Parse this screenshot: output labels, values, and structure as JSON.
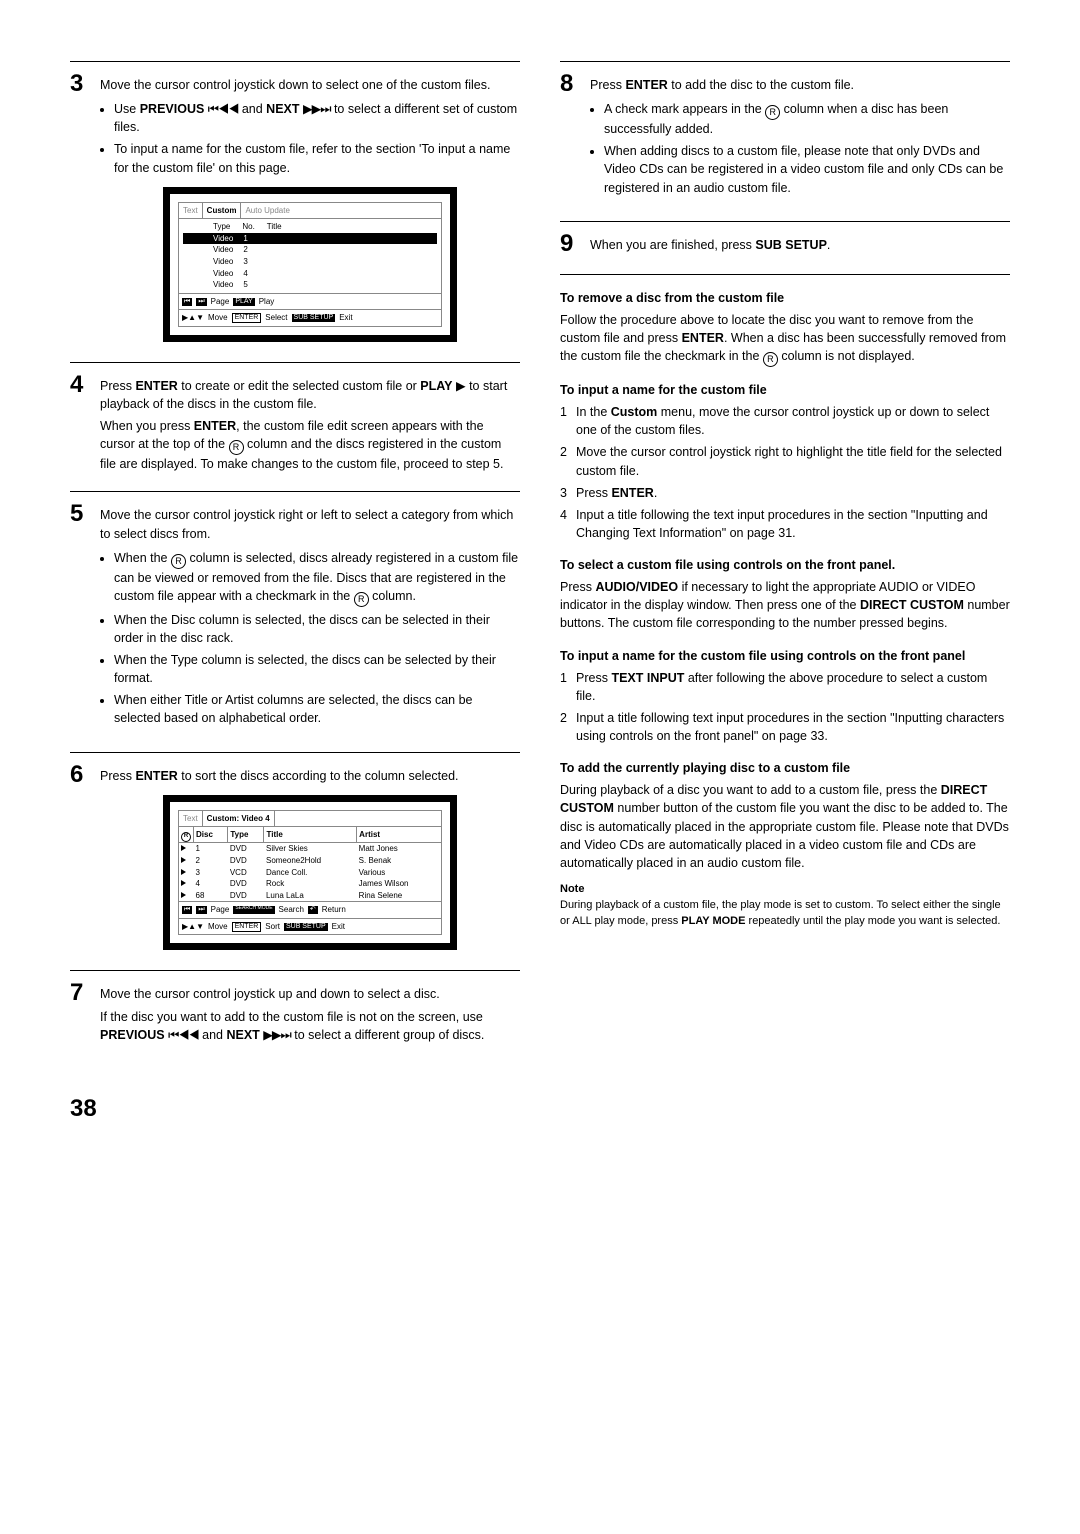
{
  "page_number": "38",
  "col1": {
    "step3": {
      "num": "3",
      "text": "Move the cursor control joystick down to select one of the custom files.",
      "bullets": {
        "b1_pre": "Use ",
        "b1_prev": "PREVIOUS",
        "b1_mid": " and ",
        "b1_next": "NEXT",
        "b1_post": " to select a different set of custom files.",
        "b2": "To input a name for the custom file, refer to the section 'To input a name for the custom file' on this page."
      }
    },
    "ui1": {
      "tabs": {
        "t1": "Text",
        "t2": "Custom",
        "t3": "Auto Update"
      },
      "header": {
        "h1": "Type",
        "h2": "No.",
        "h3": "Title"
      },
      "rows": [
        {
          "type": "Video",
          "no": "1"
        },
        {
          "type": "Video",
          "no": "2"
        },
        {
          "type": "Video",
          "no": "3"
        },
        {
          "type": "Video",
          "no": "4"
        },
        {
          "type": "Video",
          "no": "5"
        }
      ],
      "footer": {
        "page": "Page",
        "play_btn": "PLAY",
        "play": "Play",
        "move": "Move",
        "enter_btn": "ENTER",
        "select": "Select",
        "sub_btn": "SUB SETUP",
        "exit": "Exit"
      }
    },
    "step4": {
      "num": "4",
      "text_a": "Press ",
      "enter": "ENTER",
      "text_b": " to create or edit the selected custom file or ",
      "play": "PLAY",
      "text_c": " to start playback of the discs in the custom file.",
      "para_a": "When you press ",
      "para_b": ", the custom file edit screen appears with the cursor at the top of the ",
      "para_c": " column and the discs registered in the custom file are displayed. To make changes to the custom file, proceed to step 5."
    },
    "step5": {
      "num": "5",
      "text": "Move the cursor control joystick right or left to select a category from which to select discs from.",
      "b1_a": "When the ",
      "b1_b": " column is selected, discs already registered in a custom file can be viewed or removed from the file. Discs that are registered in the custom file appear with a checkmark in the ",
      "b1_c": " column.",
      "b2": "When the Disc column is selected, the discs can be selected in their order in the disc rack.",
      "b3": "When the Type column is selected, the discs can be selected by their format.",
      "b4": "When either Title or Artist columns are selected, the discs can be selected based on alphabetical order."
    },
    "step6": {
      "num": "6",
      "text_a": "Press ",
      "enter": "ENTER",
      "text_b": " to sort the discs according to the column selected."
    },
    "ui2": {
      "tabs": {
        "t1": "Text",
        "t2": "Custom: Video 4",
        "t3": ""
      },
      "headers": {
        "h1": "Disc",
        "h2": "Type",
        "h3": "Title",
        "h4": "Artist"
      },
      "rows": [
        {
          "disc": "1",
          "type": "DVD",
          "title": "Silver Skies",
          "artist": "Matt Jones"
        },
        {
          "disc": "2",
          "type": "DVD",
          "title": "Someone2Hold",
          "artist": "S. Benak"
        },
        {
          "disc": "3",
          "type": "VCD",
          "title": "Dance Coll.",
          "artist": "Various"
        },
        {
          "disc": "4",
          "type": "DVD",
          "title": "Rock",
          "artist": "James Wilson"
        },
        {
          "disc": "68",
          "type": "DVD",
          "title": "Luna LaLa",
          "artist": "Rina Selene"
        }
      ],
      "footer": {
        "page": "Page",
        "search_btn": "SEARCH MODE",
        "search": "Search",
        "return": "Return",
        "move": "Move",
        "enter_btn": "ENTER",
        "sort": "Sort",
        "sub_btn": "SUB SETUP",
        "exit": "Exit"
      }
    },
    "step7": {
      "num": "7",
      "text": "Move the cursor control joystick up and down to select a disc.",
      "para_a": "If the disc you want to add to the custom file is not on the screen, use ",
      "prev": "PREVIOUS",
      "para_b": " and ",
      "next": "NEXT",
      "para_c": " to select a different group of discs."
    }
  },
  "col2": {
    "step8": {
      "num": "8",
      "text_a": "Press ",
      "enter": "ENTER",
      "text_b": " to add the disc to the custom file.",
      "b1_a": "A check mark appears in the ",
      "b1_b": " column when a disc has been successfully added.",
      "b2": "When adding discs to a custom file, please note that only DVDs and Video CDs can be registered in a video custom file and only CDs can be registered in an audio custom file."
    },
    "step9": {
      "num": "9",
      "text_a": "When you are finished, press ",
      "sub": "SUB SETUP",
      "text_b": "."
    },
    "remove": {
      "head": "To remove a disc from the custom file",
      "body_a": "Follow the procedure above to locate the disc you want to remove from the custom file and press ",
      "enter": "ENTER",
      "body_b": ". When a disc has been successfully removed from the custom file the checkmark in the ",
      "body_c": " column is not displayed."
    },
    "inputname": {
      "head": "To input a name for the custom file",
      "s1_a": "In the ",
      "s1_bold": "Custom",
      "s1_b": " menu, move the cursor control joystick up or down to select one of the custom files.",
      "s2": "Move the cursor control joystick right to highlight the title field for the selected custom file.",
      "s3_a": "Press ",
      "s3_bold": "ENTER",
      "s3_b": ".",
      "s4": "Input a title following the text input procedures in the section \"Inputting and Changing Text Information\" on page 31."
    },
    "selectfront": {
      "head": "To select a custom file using controls on the front panel.",
      "body_a": "Press ",
      "av": "AUDIO/VIDEO",
      "body_b": " if necessary to light the appropriate AUDIO or VIDEO indicator in the display window.  Then press one of the ",
      "dc": "DIRECT CUSTOM",
      "body_c": " number buttons. The custom file corresponding to the number pressed begins."
    },
    "inputfront": {
      "head": "To input a name for the custom file using controls on the front panel",
      "s1_a": "Press ",
      "s1_bold": "TEXT INPUT",
      "s1_b": " after following the above procedure to select a custom file.",
      "s2": "Input a title following text input procedures in the section \"Inputting characters using controls on the front panel\" on page 33."
    },
    "addcurrent": {
      "head": "To add the currently playing disc to a custom file",
      "body_a": "During playback of a disc you want to add to a custom file, press the ",
      "dc": "DIRECT CUSTOM",
      "body_b": " number button of the custom file you want the disc to be added to. The disc is automatically placed in the appropriate custom file. Please note that DVDs and Video CDs are automatically placed in a video custom file and CDs are automatically placed in an audio custom file."
    },
    "note": {
      "title": "Note",
      "body_a": "During playback of a custom file, the play mode is set to custom. To select either the single or ALL play mode, press ",
      "pm": "PLAY MODE",
      "body_b": " repeatedly until the play mode you want is selected."
    }
  }
}
